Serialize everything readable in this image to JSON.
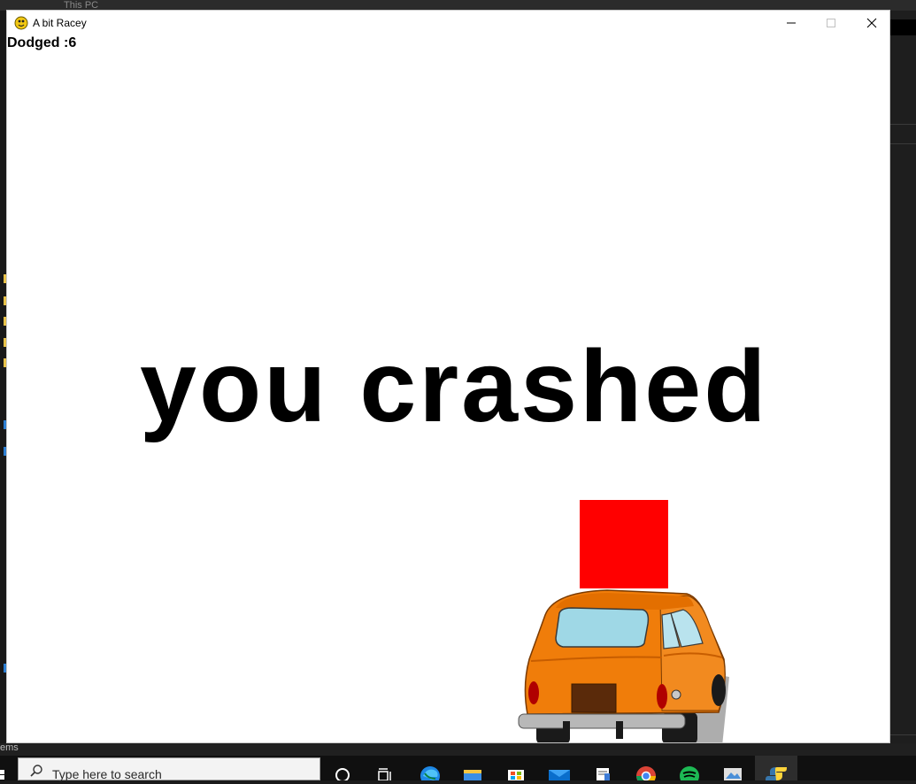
{
  "background_window": {
    "title": "This PC",
    "status_text": "ems"
  },
  "game_window": {
    "title": "A bit Racey",
    "controls": {
      "minimize": "minimize",
      "maximize": "maximize",
      "close": "close"
    },
    "score_text": "Dodged :6",
    "message": "you crashed",
    "colors": {
      "background": "#ffffff",
      "obstacle": "#ff0000",
      "car_body": "#f07d0a"
    }
  },
  "taskbar": {
    "search_placeholder": "Type here to search",
    "icons": [
      "cortana-icon",
      "task-view-icon",
      "edge-icon",
      "file-explorer-icon",
      "microsoft-store-icon",
      "mail-icon",
      "notepad-icon",
      "chrome-icon",
      "spotify-icon",
      "photos-icon",
      "python-icon"
    ]
  }
}
